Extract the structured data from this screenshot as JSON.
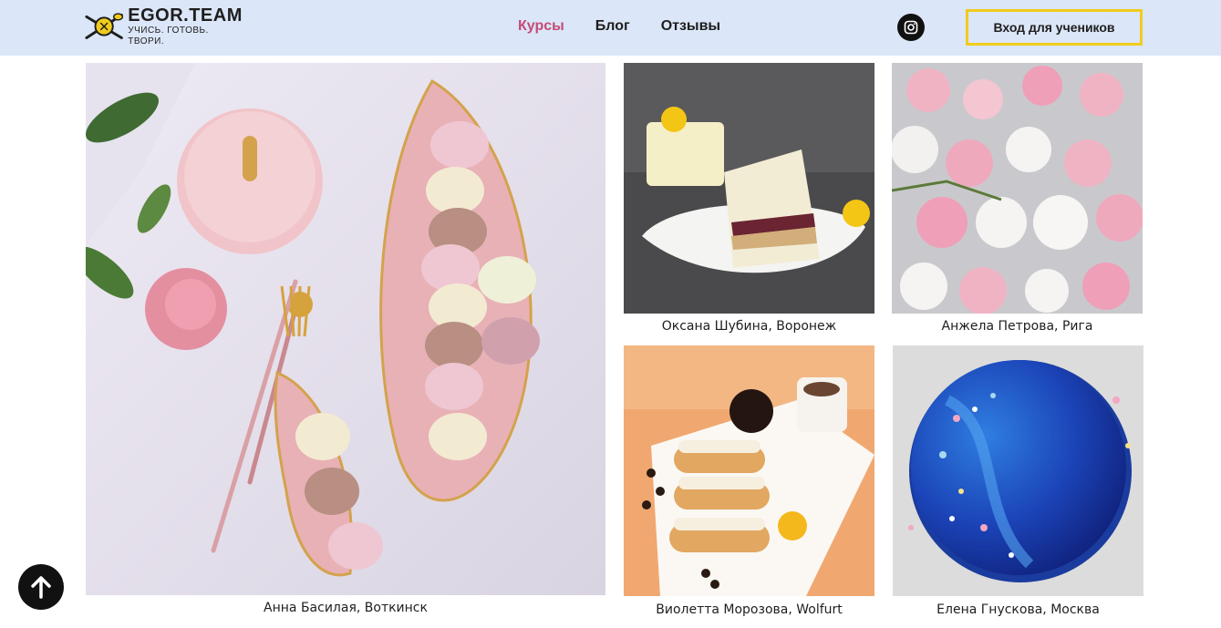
{
  "header": {
    "logo": {
      "title": "EGOR.TEAM",
      "tagline": "УЧИСЬ. ГОТОВЬ. ТВОРИ."
    },
    "nav": [
      {
        "label": "Курсы",
        "active": true
      },
      {
        "label": "Блог",
        "active": false
      },
      {
        "label": "Отзывы",
        "active": false
      }
    ],
    "social_icon": "instagram-icon",
    "login_label": "Вход для учеников",
    "colors": {
      "background": "#dbe6f8",
      "accent": "#c44b76",
      "button_border": "#f0cc1c"
    }
  },
  "gallery": [
    {
      "caption": "Анна Басилая, Воткинск",
      "subject": "macarons on pink leaf plates"
    },
    {
      "caption": "Оксана Шубина, Воронеж",
      "subject": "mousse cake slice"
    },
    {
      "caption": "Анжела Петрова, Рига",
      "subject": "pink and white zefir"
    },
    {
      "caption": "Виолетта Морозова, Wolfurt",
      "subject": "eclairs with coffee"
    },
    {
      "caption": "Елена Гнускова, Москва",
      "subject": "blue mirror glaze cake"
    }
  ],
  "scroll_top_icon": "arrow-up-icon"
}
